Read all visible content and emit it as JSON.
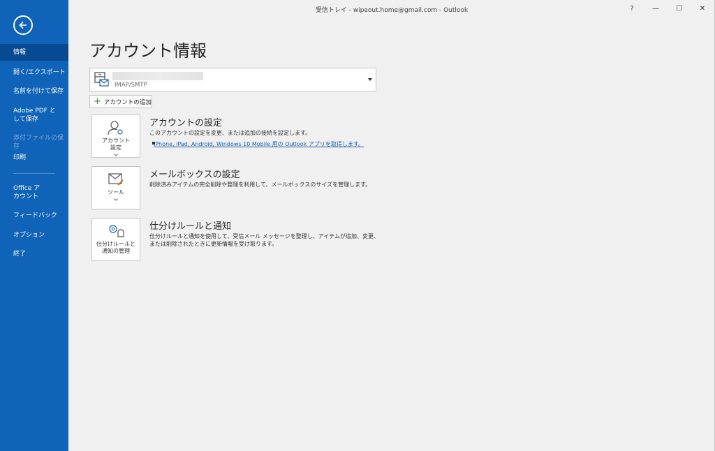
{
  "window": {
    "title": "受信トレイ - wipeout.home@gmail.com  -  Outlook",
    "controls": {
      "help": "?",
      "minimize": "—",
      "maximize": "☐",
      "close": "✕"
    }
  },
  "sidebar": {
    "items": [
      {
        "label": "情報",
        "state": "active"
      },
      {
        "label": "開く/エクスポート"
      },
      {
        "label": "名前を付けて保存"
      },
      {
        "label": "Adobe PDF として保存"
      },
      {
        "label": "添付ファイルの保存",
        "state": "disabled"
      },
      {
        "label": "印刷"
      },
      {
        "label": "Office アカウント"
      },
      {
        "label": "フィードバック"
      },
      {
        "label": "オプション"
      },
      {
        "label": "終了"
      }
    ]
  },
  "main": {
    "title": "アカウント情報",
    "account": {
      "type": "IMAP/SMTP"
    },
    "add_account_label": "アカウントの追加",
    "sections": [
      {
        "tile_label": "アカウント設定",
        "title": "アカウントの設定",
        "description": "このアカウントの設定を変更、または追加の接続を設定します。",
        "link": "iPhone, iPad, Android, Windows 10 Mobile 用の Outlook アプリを取得します。"
      },
      {
        "tile_label": "ツール",
        "title": "メールボックスの設定",
        "description": "削除済みアイテムの完全削除や整理を利用して、メールボックスのサイズを管理します。"
      },
      {
        "tile_label": "仕分けルールと通知の管理",
        "title": "仕分けルールと通知",
        "description": "仕分けルールと通知を使用して、受信メール メッセージを整理し、アイテムが追加、変更、または削除されたときに更新情報を受け取ります。"
      }
    ]
  },
  "colors": {
    "sidebar": "#0f63b8",
    "sidebar_active": "#064a91",
    "link": "#1a5fb4",
    "background": "#f0f0f0"
  }
}
